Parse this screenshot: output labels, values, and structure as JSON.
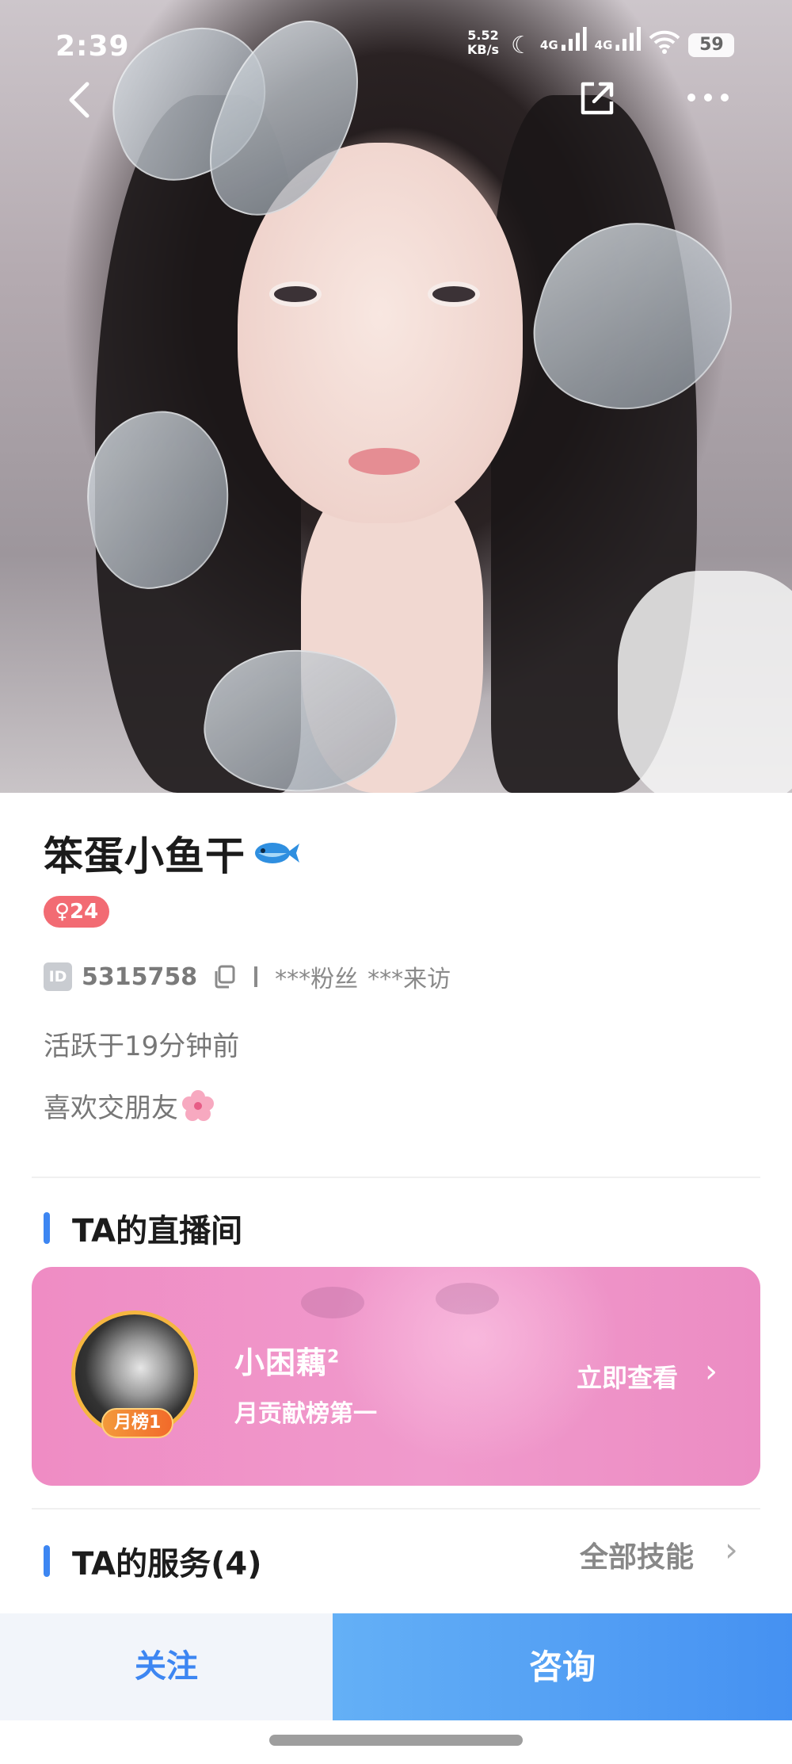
{
  "status_bar": {
    "time": "2:39",
    "net_speed_value": "5.52",
    "net_speed_unit": "KB/s",
    "signal1_label": "4G",
    "signal2_label": "4G",
    "battery": "59"
  },
  "nav": {
    "back_icon": "chevron-left-icon",
    "share_icon": "share-external-icon",
    "more_icon": "more-dots-icon"
  },
  "profile": {
    "name": "笨蛋小鱼干",
    "name_emoji": "fish-icon",
    "gender_age": "♀24",
    "id_tag": "ID",
    "id_number": "5315758",
    "fans": "***粉丝",
    "visits": "***来访",
    "active": "活跃于19分钟前",
    "bio": "喜欢交朋友",
    "bio_emoji": "cherry-blossom-icon"
  },
  "live_section": {
    "title": "TA的直播间",
    "card": {
      "rank_badge": "月榜1",
      "streamer_name": "小困藕",
      "streamer_sup": "2",
      "subtitle": "月贡献榜第一",
      "action": "立即查看",
      "chevron": "›"
    }
  },
  "services_section": {
    "title": "TA的服务(4)",
    "link": "全部技能",
    "chevron": "›"
  },
  "bottom_bar": {
    "follow": "关注",
    "consult": "咨询"
  },
  "colors": {
    "accent_blue": "#3d86f2",
    "badge_pink": "#f26b73",
    "card_pink": "#ef8cc4",
    "rank_orange": "#f26a2a"
  }
}
